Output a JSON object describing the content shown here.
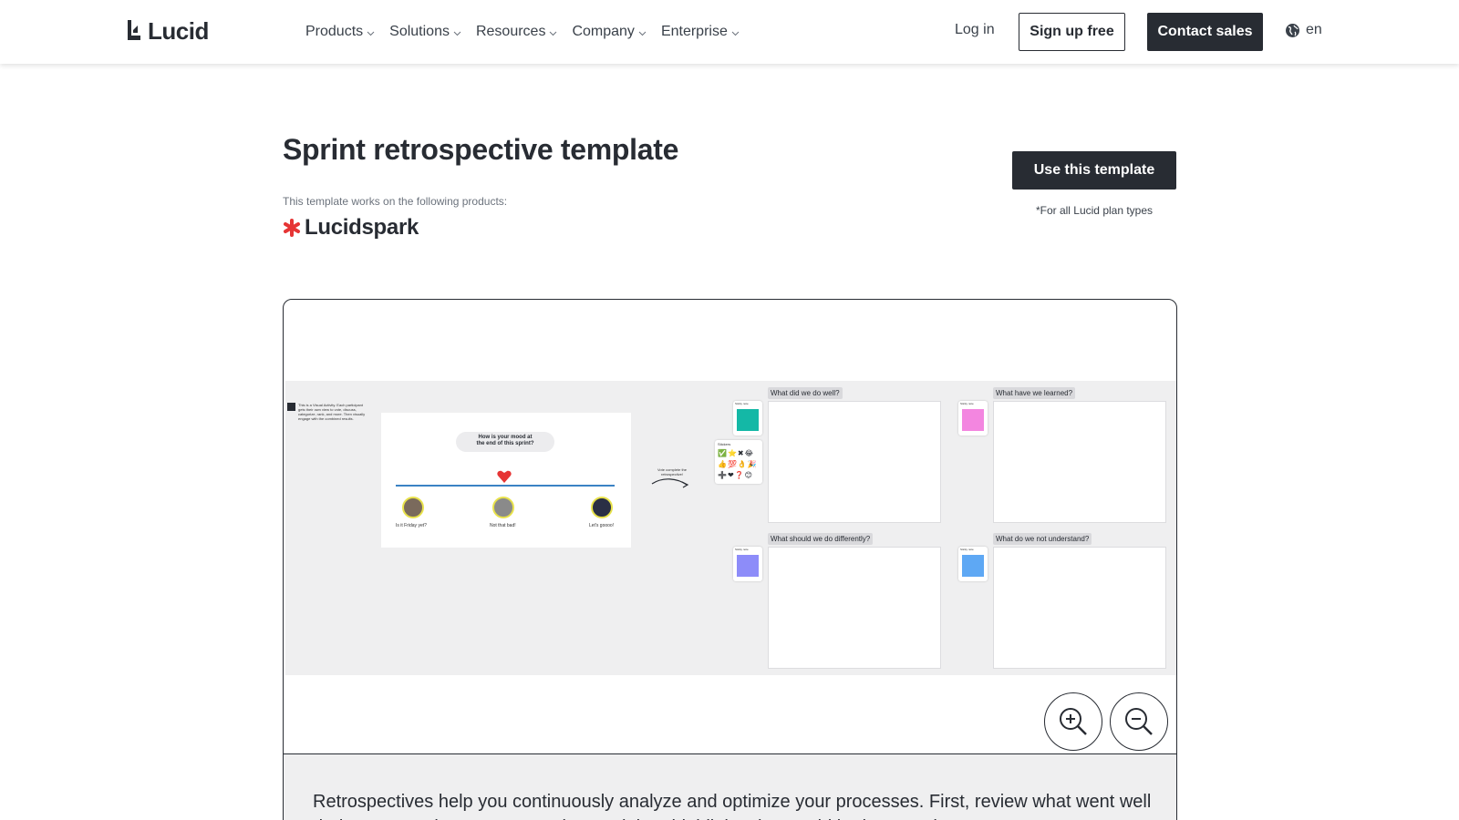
{
  "header": {
    "logo_text": "Lucid",
    "nav": [
      {
        "label": "Products"
      },
      {
        "label": "Solutions"
      },
      {
        "label": "Resources"
      },
      {
        "label": "Company"
      },
      {
        "label": "Enterprise"
      }
    ],
    "login_label": "Log in",
    "signup_label": "Sign up free",
    "contact_label": "Contact sales",
    "language": "en"
  },
  "hero": {
    "title": "Sprint retrospective template",
    "works_on": "This template works on the following products:",
    "product_name": "Lucidspark",
    "use_button": "Use this template",
    "plan_note": "*For all Lucid plan types"
  },
  "board": {
    "intro_note": "This is a Visual Activity. Each participant gets their own view to vote, discuss, categorize, rank, and more. Then visually engage with the combined results.",
    "mood_question": "How is your mood at the end of this sprint?",
    "mood_labels": [
      "Is it Friday yet?",
      "Not that bad!",
      "Let's goooo!"
    ],
    "arrow_note": "Vote complete the retrospective!",
    "stickers_label": "Stickers",
    "sticky_label": "Sticky note",
    "panels": [
      {
        "title": "What did we do well?",
        "color": "#14b8a6"
      },
      {
        "title": "What have we learned?",
        "color": "#f386e0"
      },
      {
        "title": "What should we do differently?",
        "color": "#8d8cf9"
      },
      {
        "title": "What do we not understand?",
        "color": "#5ea8f4"
      }
    ]
  },
  "zoom": {
    "in_icon": "zoom-in-icon",
    "out_icon": "zoom-out-icon"
  },
  "description": {
    "text": "Retrospectives help you continuously analyze and optimize your processes. First, review what went well during your sprint or recent project and then highlight what could be improved."
  },
  "colors": {
    "primary_dark": "#282c33",
    "brand_red": "#e63535",
    "board_bg": "#efeff0"
  }
}
